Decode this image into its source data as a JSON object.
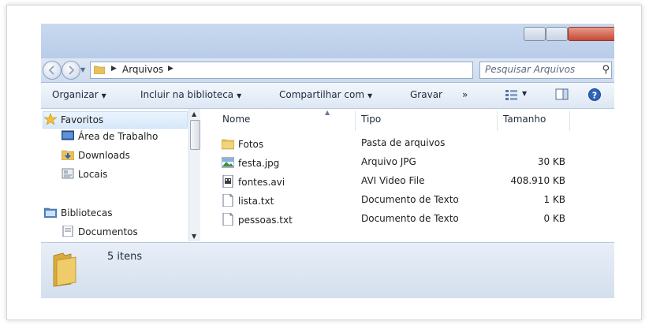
{
  "address": {
    "path": "Arquivos",
    "search_placeholder": "Pesquisar Arquivos"
  },
  "toolbar": {
    "organize": "Organizar",
    "include_library": "Incluir na biblioteca",
    "share_with": "Compartilhar com",
    "burn": "Gravar",
    "more": "»"
  },
  "nav": {
    "favorites": "Favoritos",
    "desktop": "Área de Trabalho",
    "downloads": "Downloads",
    "recent": "Locais",
    "libraries": "Bibliotecas",
    "documents": "Documentos"
  },
  "columns": {
    "name": "Nome",
    "type": "Tipo",
    "size": "Tamanho"
  },
  "files": [
    {
      "name": "Fotos",
      "type": "Pasta de arquivos",
      "size": "",
      "icon": "folder-icon"
    },
    {
      "name": "festa.jpg",
      "type": "Arquivo JPG",
      "size": "30 KB",
      "icon": "image-file-icon"
    },
    {
      "name": "fontes.avi",
      "type": "AVI Video File",
      "size": "408.910 KB",
      "icon": "video-file-icon"
    },
    {
      "name": "lista.txt",
      "type": "Documento de Texto",
      "size": "1 KB",
      "icon": "text-file-icon"
    },
    {
      "name": "pessoas.txt",
      "type": "Documento de Texto",
      "size": "0 KB",
      "icon": "text-file-icon"
    }
  ],
  "status": {
    "count": "5 itens"
  },
  "colors": {
    "window_blue": "#cddcef",
    "toolbar_light": "#f3f7fc",
    "folder_yellow": "#e8c15a"
  }
}
